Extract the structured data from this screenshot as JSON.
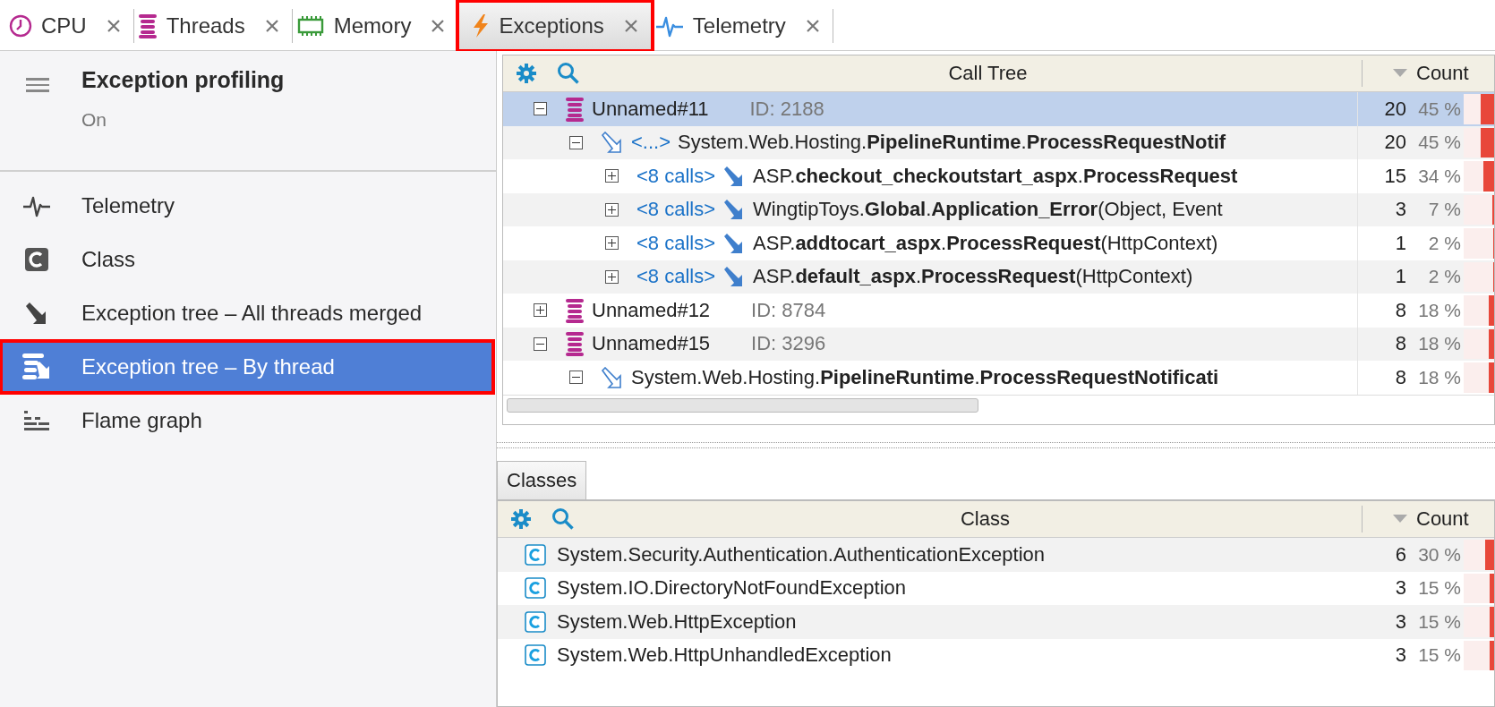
{
  "tabs": [
    {
      "label": "CPU",
      "selected": false,
      "highlighted": false
    },
    {
      "label": "Threads",
      "selected": false,
      "highlighted": false
    },
    {
      "label": "Memory",
      "selected": false,
      "highlighted": false
    },
    {
      "label": "Exceptions",
      "selected": true,
      "highlighted": true
    },
    {
      "label": "Telemetry",
      "selected": false,
      "highlighted": false
    }
  ],
  "sidebar": {
    "title": "Exception profiling",
    "status": "On",
    "items": [
      {
        "label": "Telemetry",
        "selected": false,
        "highlighted": false
      },
      {
        "label": "Class",
        "selected": false,
        "highlighted": false
      },
      {
        "label": "Exception tree – All threads merged",
        "selected": false,
        "highlighted": false
      },
      {
        "label": "Exception tree – By thread",
        "selected": true,
        "highlighted": true
      },
      {
        "label": "Flame graph",
        "selected": false,
        "highlighted": false
      }
    ]
  },
  "call_tree": {
    "column": "Call Tree",
    "count_column": "Count",
    "rows": [
      {
        "kind": "thread",
        "name": "Unnamed#11",
        "id": "ID: 2188",
        "count": "20",
        "percent": "45 %",
        "level": 0.45,
        "expanded": true,
        "selected": true,
        "children": [
          {
            "kind": "entry",
            "prefix": "<...>",
            "name": "System.Web.Hosting.**PipelineRuntime**.**ProcessRequestNotif**",
            "count": "20",
            "percent": "45 %",
            "level": 0.45,
            "expanded": true,
            "selected": false,
            "children": [
              {
                "kind": "call",
                "prefix": "<8 calls>",
                "name": "ASP.**checkout_checkoutstart_aspx**.**ProcessRequest**",
                "count": "15",
                "percent": "34 %",
                "level": 0.34,
                "expanded": false,
                "selected": false
              },
              {
                "kind": "call",
                "prefix": "<8 calls>",
                "name": "WingtipToys.**Global**.**Application_Error**(Object, Event",
                "count": "3",
                "percent": "7 %",
                "level": 0.07,
                "expanded": false,
                "selected": false
              },
              {
                "kind": "call",
                "prefix": "<8 calls>",
                "name": "ASP.**addtocart_aspx**.**ProcessRequest**(HttpContext)",
                "count": "1",
                "percent": "2 %",
                "level": 0.02,
                "expanded": false,
                "selected": false
              },
              {
                "kind": "call",
                "prefix": "<8 calls>",
                "name": "ASP.**default_aspx**.**ProcessRequest**(HttpContext)",
                "count": "1",
                "percent": "2 %",
                "level": 0.02,
                "expanded": false,
                "selected": false
              }
            ]
          }
        ]
      },
      {
        "kind": "thread",
        "name": "Unnamed#12",
        "id": "ID: 8784",
        "count": "8",
        "percent": "18 %",
        "level": 0.18,
        "expanded": false,
        "selected": false
      },
      {
        "kind": "thread",
        "name": "Unnamed#15",
        "id": "ID: 3296",
        "count": "8",
        "percent": "18 %",
        "level": 0.18,
        "expanded": true,
        "selected": false,
        "children": [
          {
            "kind": "entry",
            "name": "System.Web.Hosting.**PipelineRuntime**.**ProcessRequestNotificati**",
            "count": "8",
            "percent": "18 %",
            "level": 0.18,
            "expanded": true,
            "selected": false
          }
        ]
      }
    ]
  },
  "classes": {
    "tab": "Classes",
    "column": "Class",
    "count_column": "Count",
    "rows": [
      {
        "name": "System.Security.Authentication.AuthenticationException",
        "count": "6",
        "percent": "30 %",
        "level": 0.3
      },
      {
        "name": "System.IO.DirectoryNotFoundException",
        "count": "3",
        "percent": "15 %",
        "level": 0.15
      },
      {
        "name": "System.Web.HttpException",
        "count": "3",
        "percent": "15 %",
        "level": 0.15
      },
      {
        "name": "System.Web.HttpUnhandledException",
        "count": "3",
        "percent": "15 %",
        "level": 0.15
      }
    ]
  }
}
